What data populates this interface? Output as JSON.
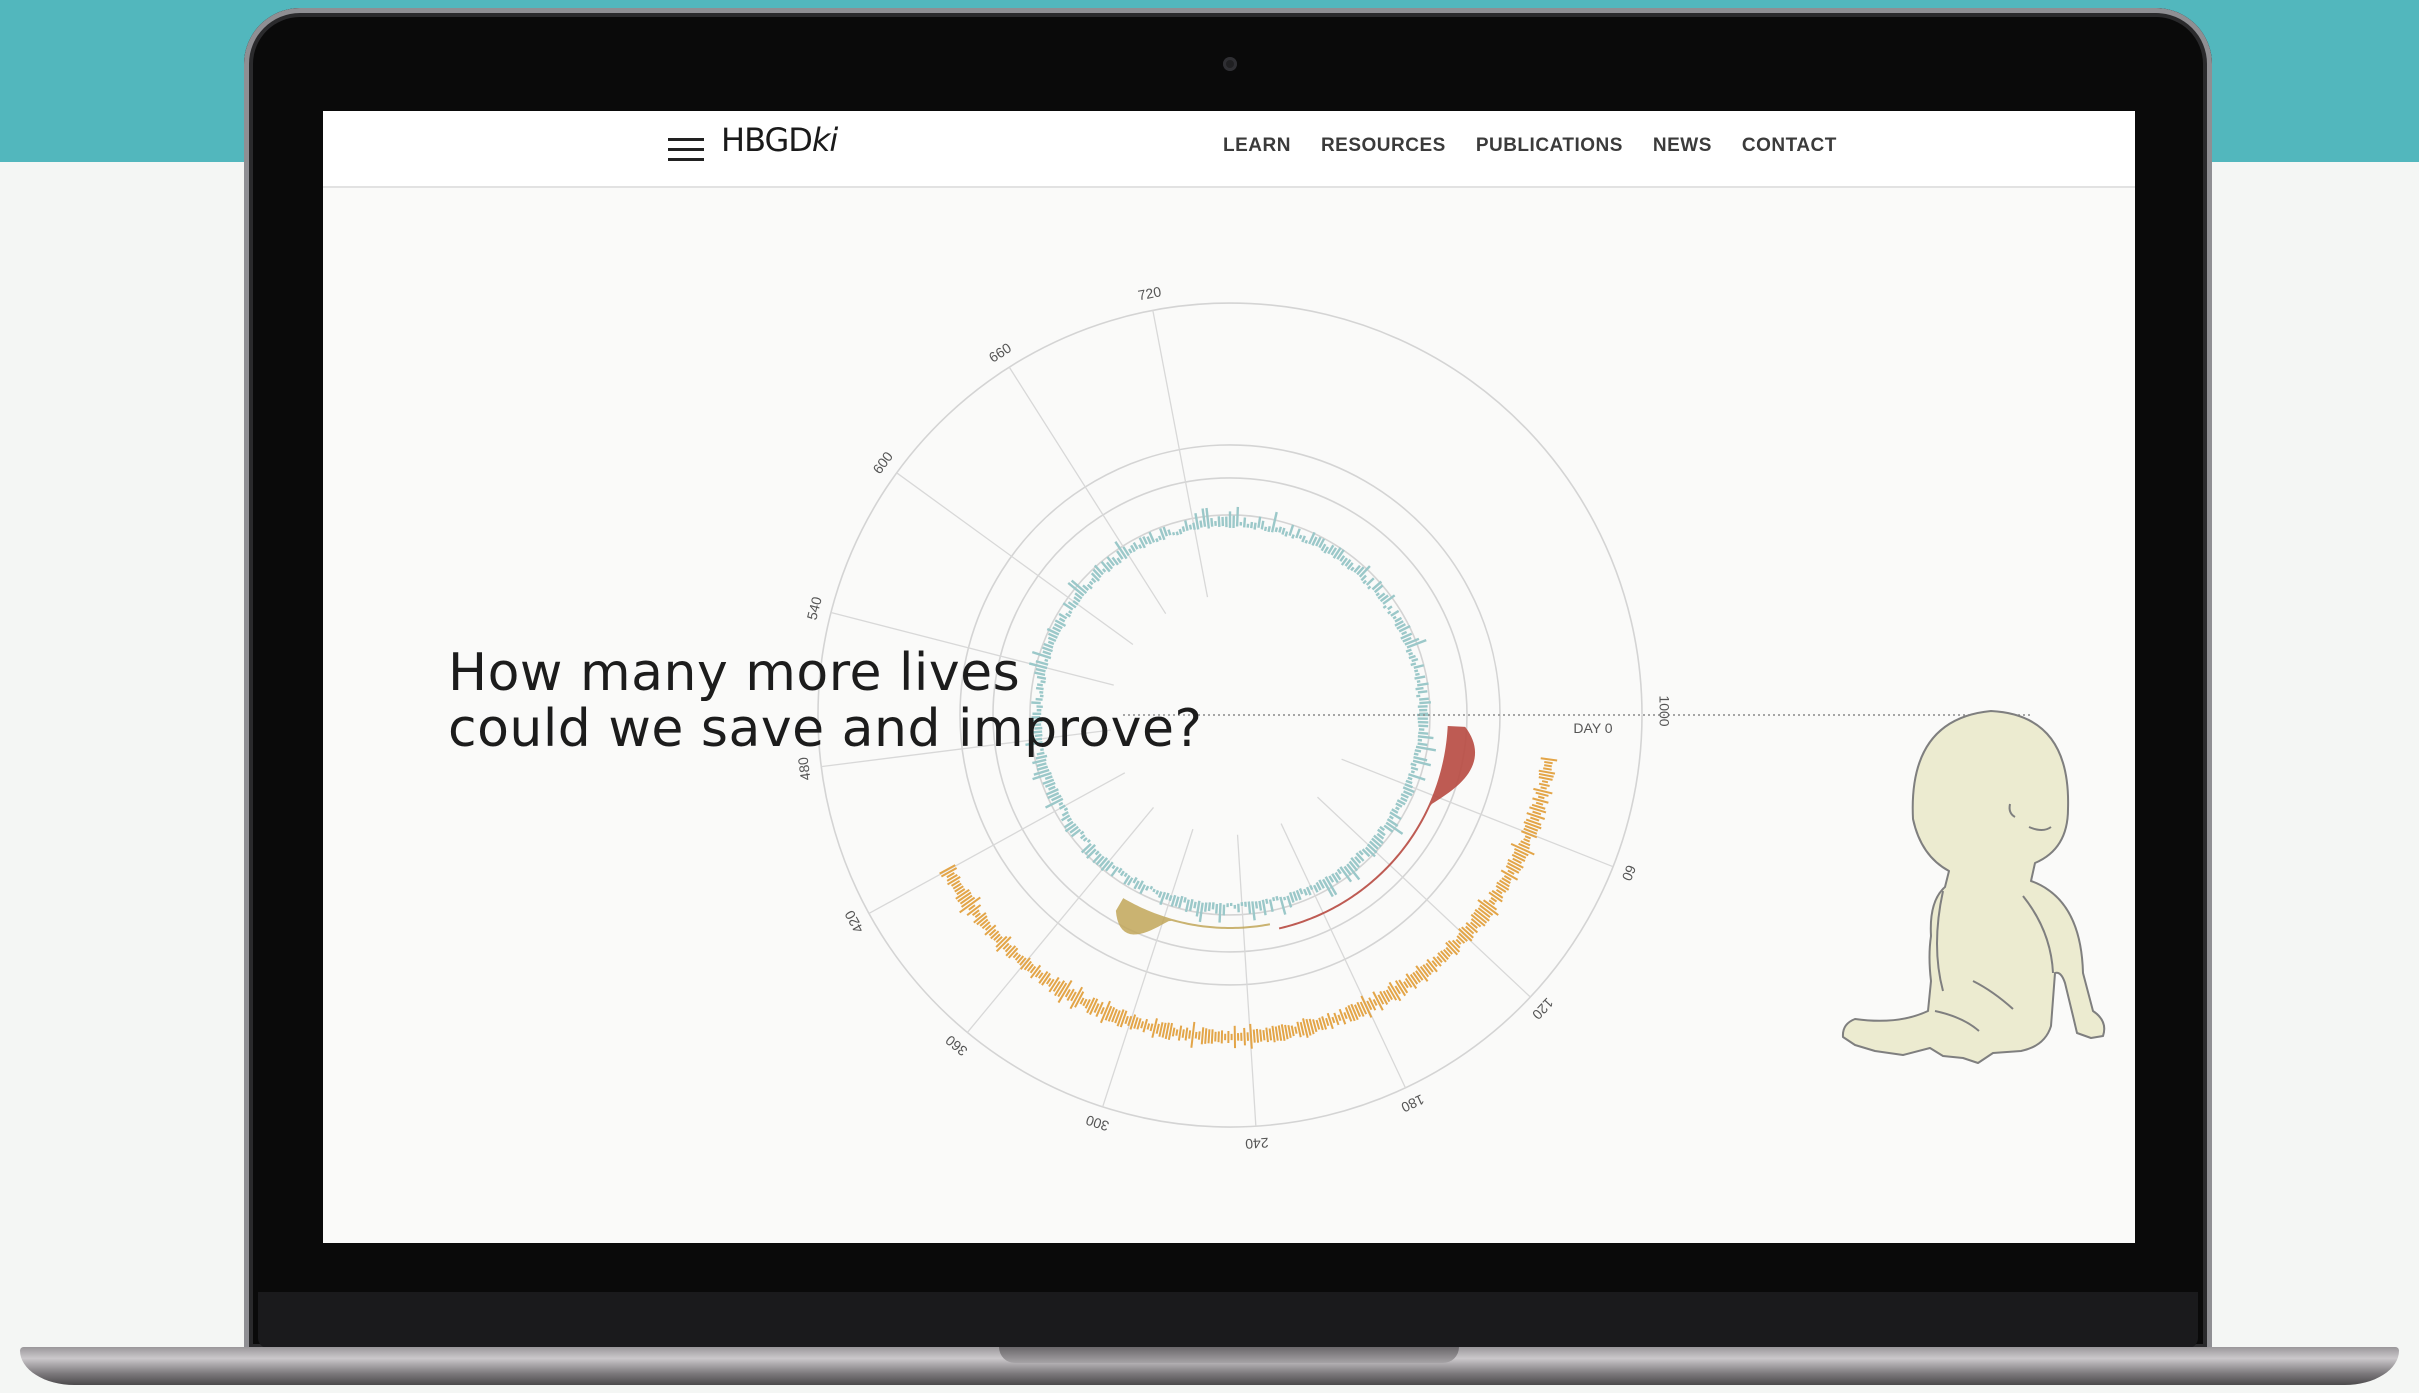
{
  "header": {
    "logo_main": "HBGD",
    "logo_suffix": "ki",
    "nav": [
      "LEARN",
      "RESOURCES",
      "PUBLICATIONS",
      "NEWS",
      "CONTACT"
    ]
  },
  "hero": {
    "headline_line1": "How many more lives",
    "headline_line2": "could we save and improve?"
  },
  "chart_data": {
    "type": "radial",
    "tick_labels": [
      "60",
      "120",
      "180",
      "240",
      "300",
      "360",
      "420",
      "480",
      "540",
      "600",
      "660",
      "720",
      "1000"
    ],
    "day_label": "DAY 0",
    "series_colors": {
      "inner": "#9bc8c9",
      "outer": "#e3a548",
      "red": "#b84d44",
      "olive": "#c1a659"
    }
  },
  "illustration": {
    "icon": "baby-illustration",
    "fill": "#ecebd0",
    "stroke": "#7f7f7f"
  }
}
